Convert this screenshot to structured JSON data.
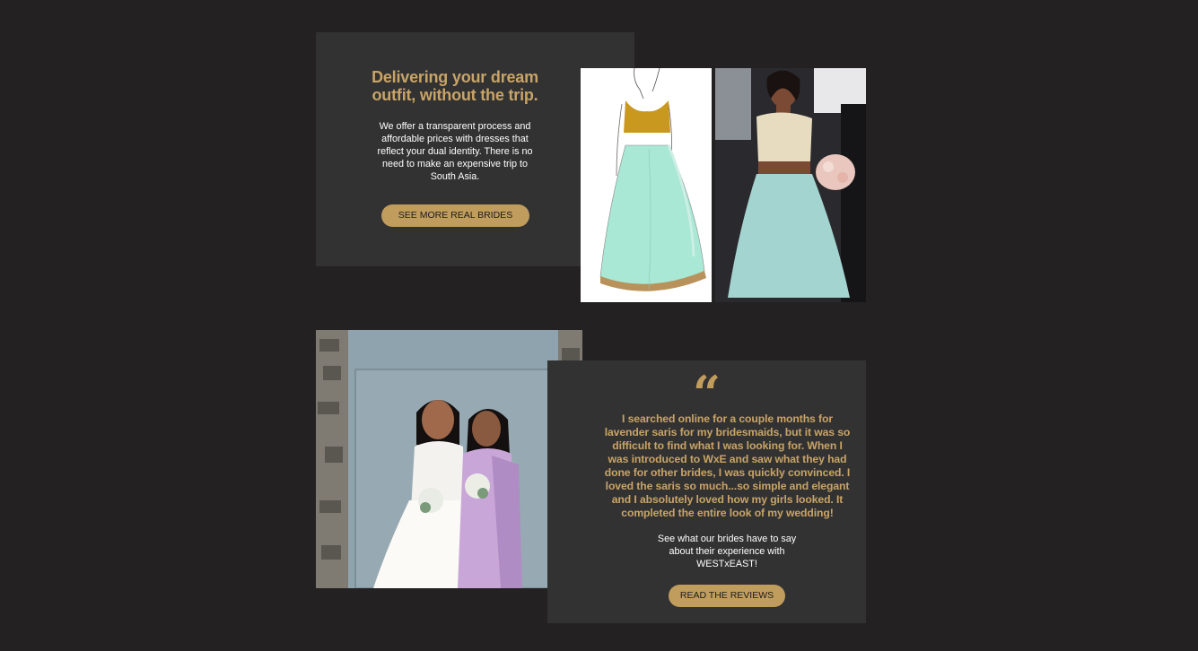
{
  "promo": {
    "headline_line1": "Delivering your dream",
    "headline_line2": "outfit, without the trip.",
    "body_line1": "We offer a transparent process and",
    "body_line2": "affordable prices with dresses that",
    "body_line3": "reflect your dual identity. There is no",
    "body_line4": "need to make an expensive trip to",
    "body_line5": "South Asia.",
    "button_label": "SEE MORE REAL BRIDES"
  },
  "testimonial": {
    "quote_mark": "“",
    "quote_lines": [
      "I searched online for a couple months for",
      "lavender saris for my bridesmaids, but it was so",
      "difficult to find what I was looking for. When I",
      "was introduced to WxE and saw what they had",
      "done for other brides, I was quickly convinced. I",
      "loved the saris so much...so simple and elegant",
      "and I absolutely loved how my girls looked. It",
      "completed the entire look of my wedding!"
    ],
    "cta_line1": "See what our brides have to say",
    "cta_line2": "about their experience with",
    "cta_line3": "WESTxEAST!",
    "button_label": "READ THE REVIEWS"
  },
  "colors": {
    "background": "#232122",
    "panel": "#333232",
    "gold": "#c19d5d",
    "gold_text": "#c8a467"
  }
}
